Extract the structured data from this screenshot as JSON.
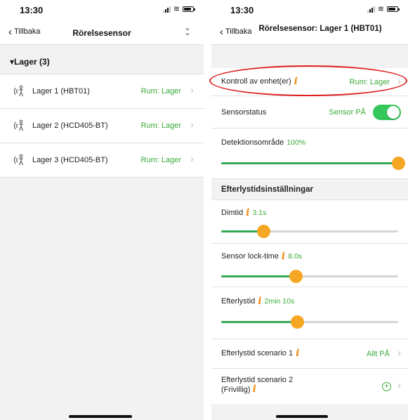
{
  "left": {
    "time": "13:30",
    "back_label": "Tillbaka",
    "title": "Rörelsesensor",
    "group_label": "▾Lager (3)",
    "devices": [
      {
        "name": "Lager 1 (HBT01)",
        "room": "Rum: Lager"
      },
      {
        "name": "Lager 2 (HCD405-BT)",
        "room": "Rum: Lager"
      },
      {
        "name": "Lager 3 (HCD405-BT)",
        "room": "Rum: Lager"
      }
    ]
  },
  "right": {
    "time": "13:30",
    "back_label": "Tillbaka",
    "title": "Rörelsesensor: Lager 1 (HBT01)",
    "control": {
      "label": "Kontroll av enhet(er)",
      "value": "Rum: Lager"
    },
    "sensor_status": {
      "label": "Sensorstatus",
      "value": "Sensor PÅ",
      "on": true
    },
    "detection": {
      "label": "Detektionsområde",
      "value": "100%",
      "level": 1.0
    },
    "section_title": "Efterlystidsinställningar",
    "dimtid": {
      "label": "Dimtid",
      "value": "3.1s",
      "level": 0.24
    },
    "lock_time": {
      "label": "Sensor lock-time",
      "value": "8.0s",
      "level": 0.42
    },
    "efterlystid": {
      "label": "Efterlystid",
      "value": "2min 10s",
      "level": 0.43
    },
    "scenario1": {
      "label": "Efterlystid scenario 1",
      "value": "Allt PÅ"
    },
    "scenario2": {
      "label_line1": "Efterlystid scenario 2",
      "label_line2": "(Frivillig)"
    }
  },
  "colors": {
    "accent_green": "#34c759",
    "slider_thumb": "#f5a623",
    "info": "#ee8c1a",
    "highlight": "#e01f1f"
  }
}
